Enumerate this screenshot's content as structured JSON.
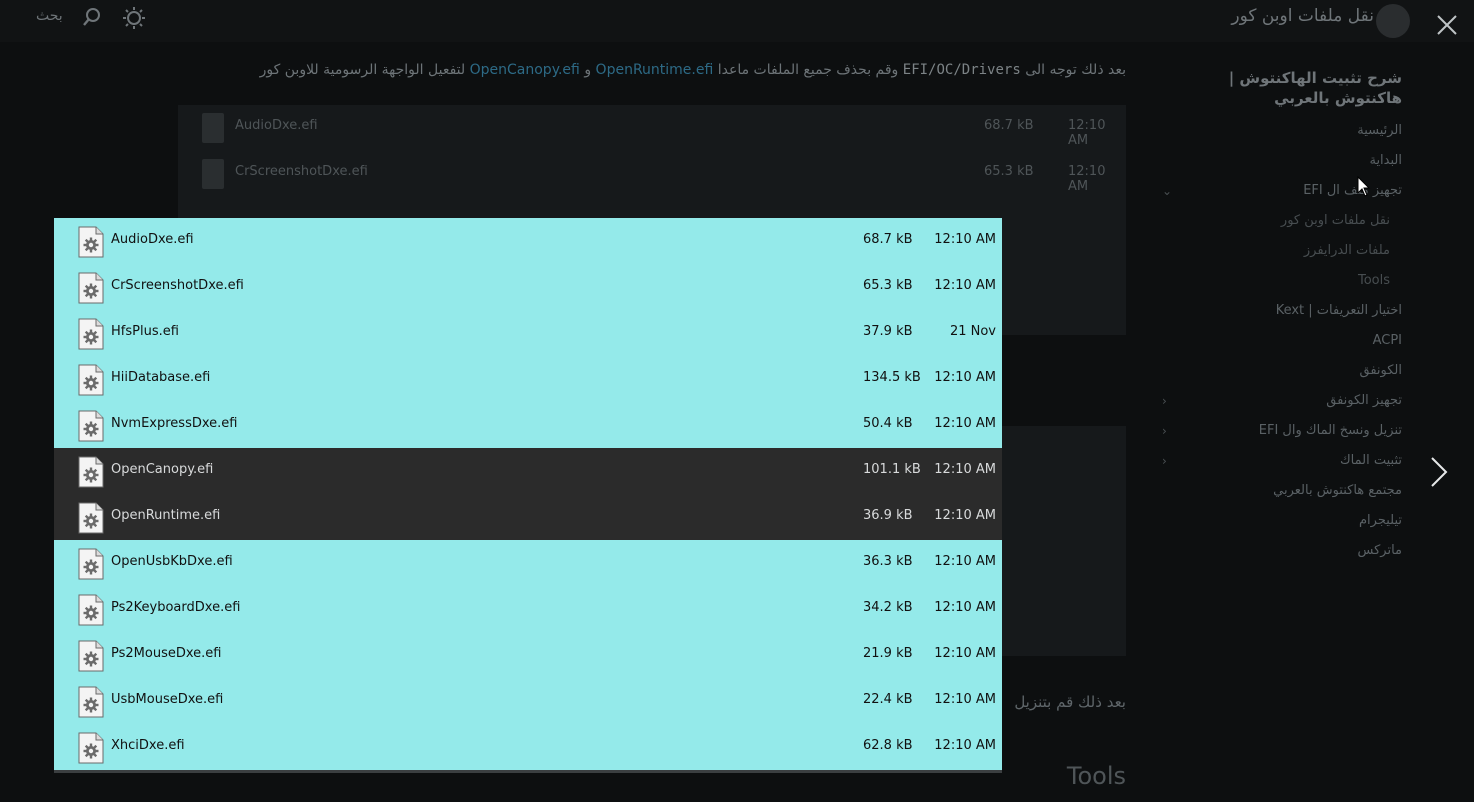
{
  "header": {
    "site_title": "نقل ملفات اوبن كور",
    "search_label": "بحث",
    "search_icon": "search-icon",
    "theme_icon": "sun-icon"
  },
  "intro": {
    "part1": "بعد ذلك توجه الى",
    "path": "EFI/OC/Drivers",
    "part2": "وقم بحذف جميع الملفات ماعدا",
    "file1": "OpenRuntime.efi",
    "and": "و",
    "file2": "OpenCanopy.efi",
    "part3": "لتفعيل الواجهة الرسومية للاوبن كور"
  },
  "outro": "بعد ذلك قم بتنزيل",
  "section_heading": "Tools",
  "sidebar": {
    "title": "شرح تثبيت الهاكنتوش | هاكنتوش بالعربي",
    "items": [
      {
        "label": "الرئيسية"
      },
      {
        "label": "البداية"
      },
      {
        "label": "تجهيز ملف ال EFI"
      },
      {
        "label": "نقل ملفات اوبن كور"
      },
      {
        "label": "ملفات الدرايفرز"
      },
      {
        "label": "Tools"
      },
      {
        "label": "اختيار التعريفات | Kext"
      },
      {
        "label": "ACPI"
      },
      {
        "label": "الكونفق"
      },
      {
        "label": "تجهيز الكونفق"
      },
      {
        "label": "تنزيل ونسخ الماك وال EFI"
      },
      {
        "label": "تثبيت الماك"
      },
      {
        "label": "مجتمع هاكنتوش بالعربي"
      },
      {
        "label": "تيليجرام"
      },
      {
        "label": "ماتركس"
      }
    ]
  },
  "files": [
    {
      "name": "AudioDxe.efi",
      "size": "68.7 kB",
      "time": "12:10 AM",
      "selected": false
    },
    {
      "name": "CrScreenshotDxe.efi",
      "size": "65.3 kB",
      "time": "12:10 AM",
      "selected": false
    },
    {
      "name": "HfsPlus.efi",
      "size": "37.9 kB",
      "time": "21 Nov",
      "selected": false
    },
    {
      "name": "HiiDatabase.efi",
      "size": "134.5 kB",
      "time": "12:10 AM",
      "selected": false
    },
    {
      "name": "NvmExpressDxe.efi",
      "size": "50.4 kB",
      "time": "12:10 AM",
      "selected": false
    },
    {
      "name": "OpenCanopy.efi",
      "size": "101.1 kB",
      "time": "12:10 AM",
      "selected": true
    },
    {
      "name": "OpenRuntime.efi",
      "size": "36.9 kB",
      "time": "12:10 AM",
      "selected": true
    },
    {
      "name": "OpenUsbKbDxe.efi",
      "size": "36.3 kB",
      "time": "12:10 AM",
      "selected": false
    },
    {
      "name": "Ps2KeyboardDxe.efi",
      "size": "34.2 kB",
      "time": "12:10 AM",
      "selected": false
    },
    {
      "name": "Ps2MouseDxe.efi",
      "size": "21.9 kB",
      "time": "12:10 AM",
      "selected": false
    },
    {
      "name": "UsbMouseDxe.efi",
      "size": "22.4 kB",
      "time": "12:10 AM",
      "selected": false
    },
    {
      "name": "XhciDxe.efi",
      "size": "62.8 kB",
      "time": "12:10 AM",
      "selected": false
    }
  ],
  "colors": {
    "panel_background": "#94eaea",
    "selected_row": "#2b2b2b",
    "overlay": "#0d0f10"
  }
}
